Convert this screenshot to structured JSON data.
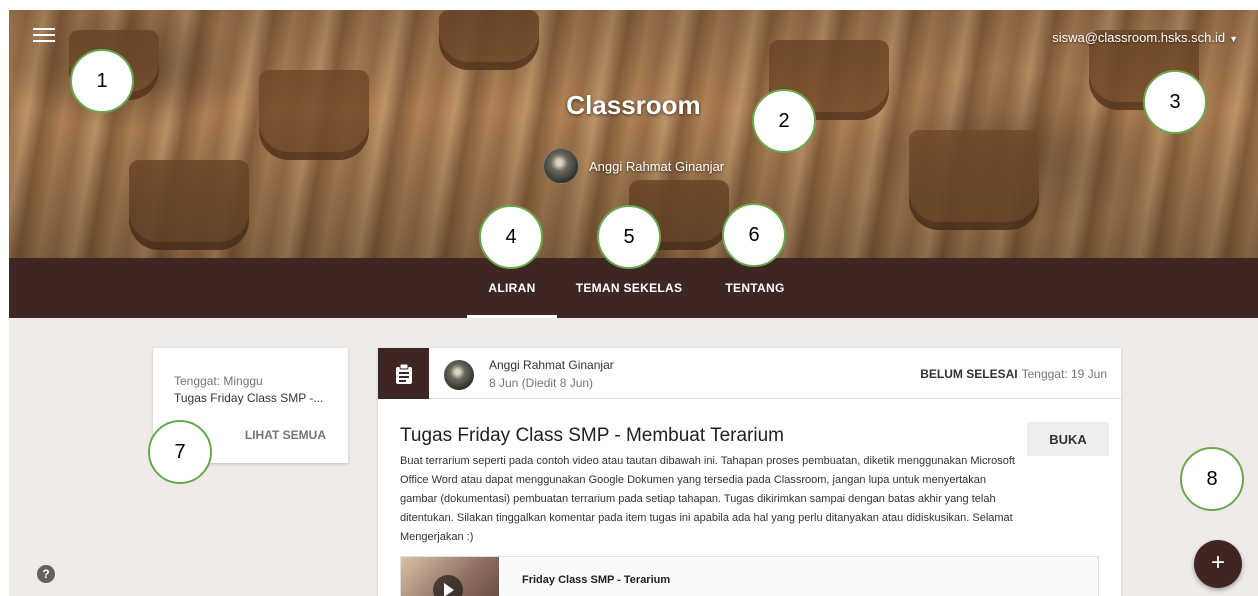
{
  "header": {
    "account_email": "siswa@classroom.hsks.sch.id",
    "class_title": "Classroom",
    "teacher_name": "Anggi Rahmat Ginanjar"
  },
  "tabs": [
    {
      "label": "ALIRAN",
      "active": true
    },
    {
      "label": "TEMAN SEKELAS",
      "active": false
    },
    {
      "label": "TENTANG",
      "active": false
    }
  ],
  "upcoming": {
    "label": "Tenggat: Minggu",
    "item": "Tugas Friday Class SMP -...",
    "see_all": "LIHAT SEMUA"
  },
  "post": {
    "author": "Anggi Rahmat Ginanjar",
    "date": "8 Jun (Diedit 8 Jun)",
    "status": "BELUM SELESAI",
    "due": "Tenggat: 19 Jun",
    "title": "Tugas Friday Class SMP - Membuat Terarium",
    "open_label": "BUKA",
    "description": "Buat terrarium seperti pada contoh video atau tautan dibawah ini. Tahapan proses pembuatan, diketik menggunakan Microsoft Office Word atau dapat menggunakan Google Dokumen yang tersedia pada Classroom, jangan lupa untuk menyertakan gambar (dokumentasi) pembuatan terrarium pada setiap tahapan. Tugas dikirimkan sampai dengan batas akhir yang telah ditentukan. Silakan tinggalkan komentar pada item tugas ini apabila ada hal yang perlu ditanyakan atau didiskusikan. Selamat Mengerjakan :)",
    "attachment_title": "Friday Class SMP - Terarium"
  },
  "fab_label": "+",
  "help_label": "?",
  "callouts": [
    "1",
    "2",
    "3",
    "4",
    "5",
    "6",
    "7",
    "8"
  ],
  "colors": {
    "primary": "#3e2723",
    "background": "#efebe9",
    "callout_border": "#6aa84f"
  }
}
